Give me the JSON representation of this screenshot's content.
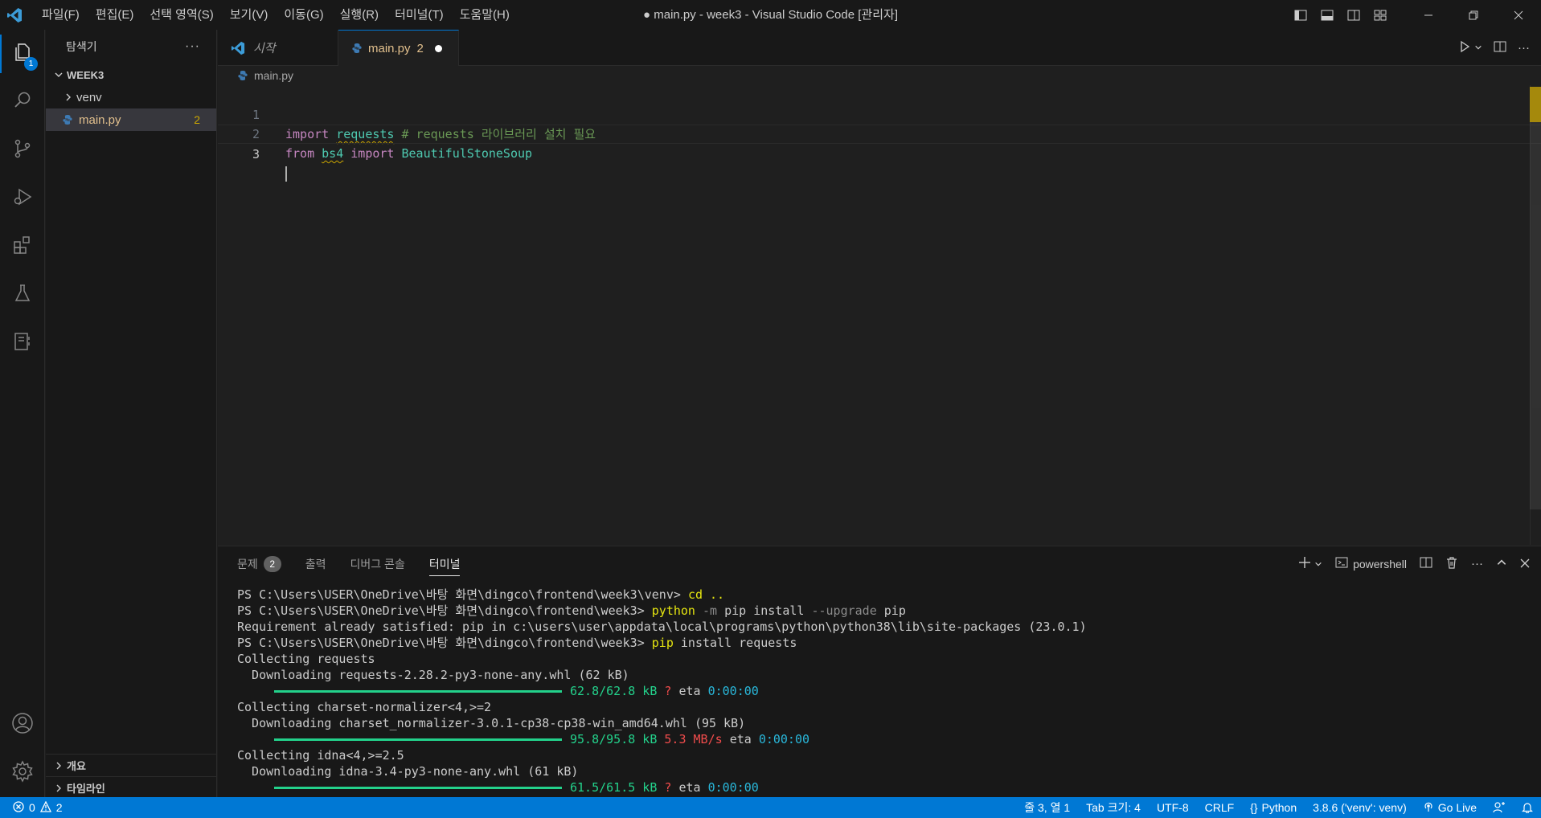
{
  "window": {
    "title": "● main.py - week3 - Visual Studio Code [관리자]"
  },
  "menu": [
    "파일(F)",
    "편집(E)",
    "선택 영역(S)",
    "보기(V)",
    "이동(G)",
    "실행(R)",
    "터미널(T)",
    "도움말(H)"
  ],
  "activity_bar": {
    "explorer_badge": "1",
    "items": [
      "files-icon",
      "search-icon",
      "source-control-icon",
      "run-debug-icon",
      "extensions-icon",
      "testing-icon",
      "notebook-icon"
    ],
    "bottom": [
      "account-icon",
      "manage-gear-icon"
    ]
  },
  "sidebar": {
    "title": "탐색기",
    "more": "···",
    "root_folder": "WEEK3",
    "items": [
      {
        "label": "venv",
        "type": "folder"
      },
      {
        "label": "main.py",
        "type": "file",
        "count": "2"
      }
    ],
    "sections": [
      "개요",
      "타임라인"
    ]
  },
  "tabs": [
    {
      "label": "시작"
    },
    {
      "label": "main.py",
      "count": "2"
    }
  ],
  "breadcrumb": "main.py",
  "editor": {
    "line_numbers": [
      "1",
      "2",
      "3"
    ],
    "line1": {
      "kw": "import",
      "module": "requests",
      "comment": "# requests 라이브러리 설치 필요"
    },
    "line2": {
      "kw1": "from",
      "module": "bs4",
      "kw2": "import",
      "name": "BeautifulStoneSoup"
    }
  },
  "panel": {
    "tabs": [
      {
        "label": "문제",
        "badge": "2"
      },
      {
        "label": "출력"
      },
      {
        "label": "디버그 콘솔"
      },
      {
        "label": "터미널"
      }
    ],
    "shell": "powershell",
    "terminal": {
      "prompt": "PS C:\\Users\\USER\\OneDrive\\바탕 화면\\dingco\\frontend\\week3\\venv>",
      "cmd1": "cd ..",
      "prompt2": "PS C:\\Users\\USER\\OneDrive\\바탕 화면\\dingco\\frontend\\week3>",
      "cmd2_a": "python",
      "cmd2_b": "-m",
      "cmd2_c": "pip install",
      "cmd2_d": "--upgrade",
      "cmd2_e": "pip",
      "out1": "Requirement already satisfied: pip in c:\\users\\user\\appdata\\local\\programs\\python\\python38\\lib\\site-packages (23.0.1)",
      "cmd3_a": "pip",
      "cmd3_b": "install requests",
      "out2": "Collecting requests",
      "out3": "  Downloading requests-2.28.2-py3-none-any.whl (62 kB)",
      "bar1_size": "62.8/62.8 kB",
      "bar1_speed": "?",
      "bar1_eta": "0:00:00",
      "out4": "Collecting charset-normalizer<4,>=2",
      "out5": "  Downloading charset_normalizer-3.0.1-cp38-cp38-win_amd64.whl (95 kB)",
      "bar2_size": "95.8/95.8 kB",
      "bar2_speed": "5.3 MB/s",
      "bar2_eta": "0:00:00",
      "out6": "Collecting idna<4,>=2.5",
      "out7": "  Downloading idna-3.4-py3-none-any.whl (61 kB)",
      "bar3_size": "61.5/61.5 kB",
      "bar3_speed": "?",
      "bar3_eta": "0:00:00",
      "eta_label": "eta"
    }
  },
  "status": {
    "errors": "0",
    "warnings": "2",
    "position": "줄 3, 열 1",
    "tab_size": "Tab 크기: 4",
    "encoding": "UTF-8",
    "eol": "CRLF",
    "language": "Python",
    "interpreter": "3.8.6 ('venv': venv)",
    "golive": "Go Live"
  },
  "colors": {
    "accent": "#0078d4",
    "keyword": "#c586c0",
    "module": "#4ec9b0",
    "comment": "#6a9955",
    "warning": "#cca700"
  }
}
